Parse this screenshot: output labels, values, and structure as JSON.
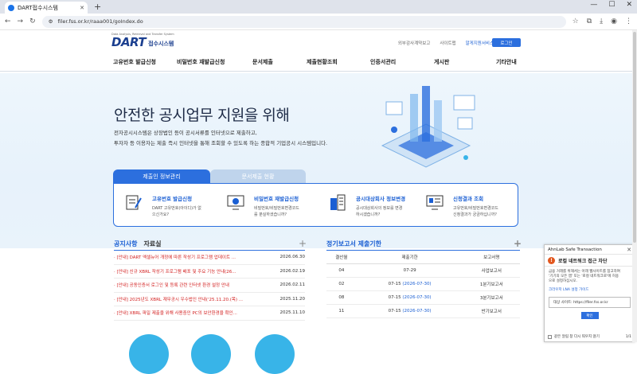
{
  "browser": {
    "tab_title": "DART접수시스템",
    "url": "filer.fss.or.kr/raaa001/goIndex.do"
  },
  "header": {
    "logo_small": "Data Analysis, Retrieval and Transfer System",
    "logo_main": "DART",
    "logo_sub": "접수시스템",
    "links": [
      "외부감사계약보고",
      "사이트맵",
      "알게지원서비스"
    ],
    "login": "로그인"
  },
  "nav": [
    "고유번호 발급신청",
    "비밀번호 재발급신청",
    "문서제출",
    "제출현황조회",
    "인증서관리",
    "게시판",
    "기타안내"
  ],
  "hero": {
    "title": "안전한 공시업무 지원을 위해",
    "line1": "전자공시시스템은 상장법인 등이 공시서류를 인터넷으로 제출하고,",
    "line2": "투자자 등 이용자는 제출 즉시 인터넷을 통해 조회할 수 있도록 하는 종합적 기업공시 시스템입니다."
  },
  "tabs": [
    "제출인 정보관리",
    "문서제출 현황"
  ],
  "panel": [
    {
      "title": "고유번호 발급신청",
      "d1": "DART 고유번호(아이디)가 없",
      "d2": "으신가요?"
    },
    {
      "title": "비밀번호 재발급신청",
      "d1": "비밀번호/비밀번호변경코드",
      "d2": "를 분실하셨습니까?"
    },
    {
      "title": "공시대상회사 정보변경",
      "d1": "공시대상회사의 정보를 변경",
      "d2": "하시겠습니까?"
    },
    {
      "title": "신청결과 조회",
      "d1": "고유번호/비밀번호변경코드",
      "d2": "신청결과가 궁금하십니까?"
    }
  ],
  "notice": {
    "tab_active": "공지사항",
    "tab_other": "자료실",
    "plus": "+",
    "items": [
      {
        "text": "· [안내] DART 엑셀뉴어 개정에 따른 작성기 프로그램 업데이트 ...",
        "date": "2026.06.30"
      },
      {
        "text": "· [안내] 신규 XBRL 작성기 프로그램 배포 및 주요 기능 안내(26...",
        "date": "2026.02.19"
      },
      {
        "text": "· [안내] 공동인증서 로그인 및 등록 관련 인터넷 환경 설정 안내",
        "date": "2026.02.11"
      },
      {
        "text": "· [안내] 2025년도 XBRL 재무공시 우수법인 안내('25.11.20.(목) ...",
        "date": "2025.11.20"
      },
      {
        "text": "· [안내] XBRL 파일 제출을 위해 사용중인 PC의 보안환경을 확인...",
        "date": "2025.11.10"
      }
    ]
  },
  "report": {
    "title": "정기보고서 제출기한",
    "plus": "+",
    "headers": [
      "결산월",
      "제출기한",
      "보고서명"
    ],
    "rows": [
      {
        "m": "04",
        "deadline": "07-29",
        "extra": "",
        "name": "사업보고서"
      },
      {
        "m": "02",
        "deadline": "07-15",
        "extra": "(2026-07-30)",
        "name": "1분기보고서"
      },
      {
        "m": "08",
        "deadline": "07-15",
        "extra": "(2026-07-30)",
        "name": "3분기보고서"
      },
      {
        "m": "11",
        "deadline": "07-15",
        "extra": "(2026-07-30)",
        "name": "반기보고서"
      }
    ]
  },
  "popup": {
    "title": "AhnLab Safe Transaction",
    "close": "✕",
    "warn": "로컬 네트워크 접근 차단",
    "body1": "금융 거래를 위해서는 아래 웹사이트를 참고하여",
    "body2": "'기기의 모든 앱' 또는 '로컬 네트워크로'에 허용",
    "body3": "으로 설정하십시오.",
    "link": "크라우저 LNA 설정 가이드",
    "site": "대상 사이트: https://filer.fss.or.kr",
    "confirm": "확인",
    "footer": "같은 알림 창 다시 띄우지 않기",
    "page": "1/1"
  }
}
